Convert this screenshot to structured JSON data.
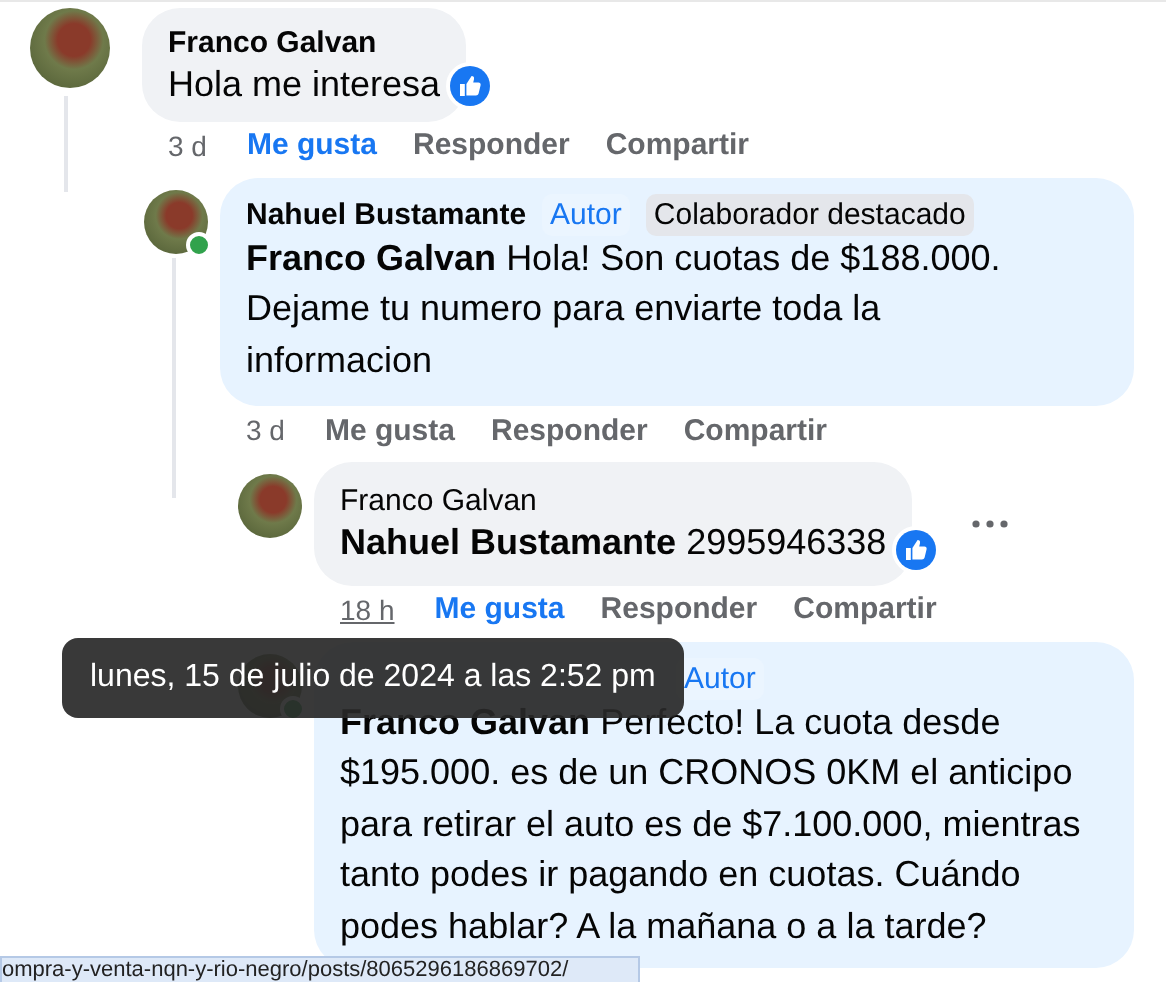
{
  "comments": [
    {
      "author": "Franco Galvan",
      "author_bold": true,
      "text": "Hola me interesa",
      "like_reaction": true,
      "time": "3 d",
      "liked": true,
      "actions": [
        "Me gusta",
        "Responder",
        "Compartir"
      ],
      "children": [
        {
          "author": "Nahuel Bustamante",
          "author_bold": true,
          "online": true,
          "badges": [
            {
              "kind": "author",
              "label": "Autor"
            },
            {
              "kind": "top",
              "label": "Colaborador destacado"
            }
          ],
          "mention": "Franco Galvan",
          "text": "Hola! Son cuotas de $188.000. Dejame tu numero para enviarte toda la informacion",
          "like_reaction": false,
          "time": "3 d",
          "liked": false,
          "actions": [
            "Me gusta",
            "Responder",
            "Compartir"
          ],
          "children": [
            {
              "author": "Franco Galvan",
              "author_bold": false,
              "mention": "Nahuel Bustamante",
              "text": "2995946338",
              "like_reaction": true,
              "menu_button": true,
              "time": "18 h",
              "time_hovered": true,
              "liked": true,
              "actions": [
                "Me gusta",
                "Responder",
                "Compartir"
              ]
            },
            {
              "online": true,
              "badges": [
                {
                  "kind": "author",
                  "label": "Autor"
                }
              ],
              "mention": "Franco Galvan",
              "text": "Perfecto! La cuota desde $195.000. es de un CRONOS 0KM el anticipo para retirar el auto es de $7.100.000, mientras tanto podes ir pagando en cuotas. Cuándo podes hablar? A la mañana o a la tarde?",
              "like_reaction": false
            }
          ]
        }
      ]
    }
  ],
  "tooltip": "lunes, 15 de julio de 2024 a las 2:52 pm",
  "status_url": "ompra-y-venta-nqn-y-rio-negro/posts/8065296186869702/"
}
